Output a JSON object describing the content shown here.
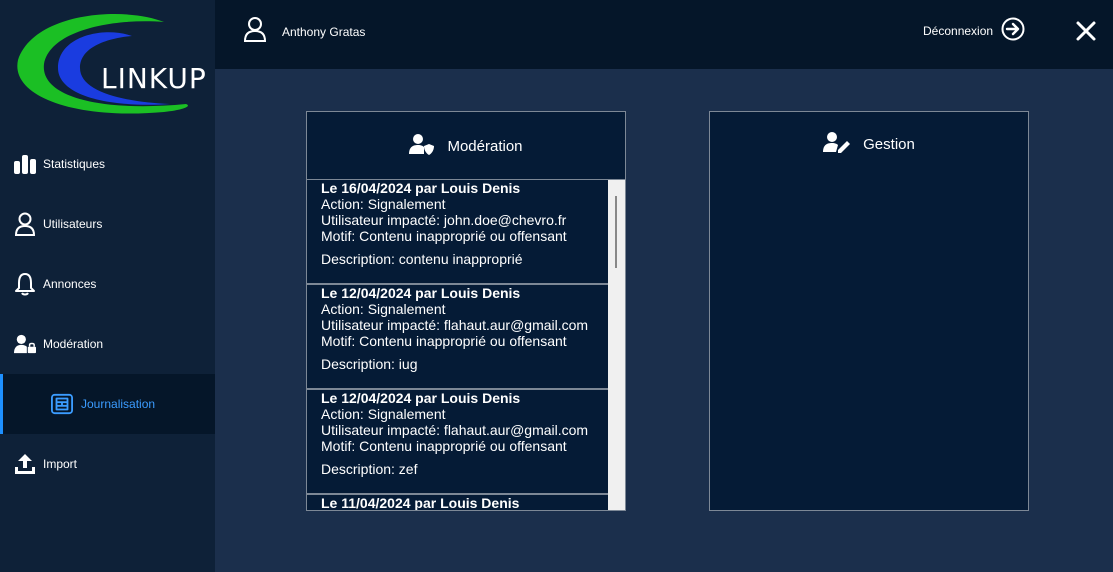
{
  "app": {
    "logo_text": "LINKUP"
  },
  "header": {
    "user_name": "Anthony Gratas",
    "logout_label": "Déconnexion"
  },
  "sidebar": {
    "items": [
      {
        "label": "Statistiques",
        "icon": "bar-chart-icon"
      },
      {
        "label": "Utilisateurs",
        "icon": "user-icon"
      },
      {
        "label": "Annonces",
        "icon": "bell-icon"
      },
      {
        "label": "Modération",
        "icon": "user-lock-icon"
      },
      {
        "label": "Journalisation",
        "icon": "journal-icon",
        "active": true
      },
      {
        "label": "Import",
        "icon": "upload-icon"
      }
    ]
  },
  "panels": {
    "moderation": {
      "title": "Modération",
      "entries": [
        {
          "header": "Le 16/04/2024 par Louis Denis",
          "action": "Action: Signalement",
          "user": "Utilisateur impacté: john.doe@chevro.fr",
          "motif": "Motif: Contenu inapproprié ou offensant",
          "description": "Description: contenu inapproprié"
        },
        {
          "header": "Le 12/04/2024 par Louis Denis",
          "action": "Action: Signalement",
          "user": "Utilisateur impacté: flahaut.aur@gmail.com",
          "motif": "Motif: Contenu inapproprié ou offensant",
          "description": "Description: iug"
        },
        {
          "header": "Le 12/04/2024 par Louis Denis",
          "action": "Action: Signalement",
          "user": "Utilisateur impacté: flahaut.aur@gmail.com",
          "motif": "Motif: Contenu inapproprié ou offensant",
          "description": "Description: zef"
        },
        {
          "header": "Le 11/04/2024 par Louis Denis"
        }
      ]
    },
    "gestion": {
      "title": "Gestion"
    }
  },
  "colors": {
    "sidebar_bg": "#0e2138",
    "header_bg": "#051629",
    "content_bg": "#1b2f4c",
    "panel_bg": "#051b36",
    "active_accent": "#1e90ff",
    "logo_green": "#1bbf24",
    "logo_blue": "#1a3ce0"
  }
}
